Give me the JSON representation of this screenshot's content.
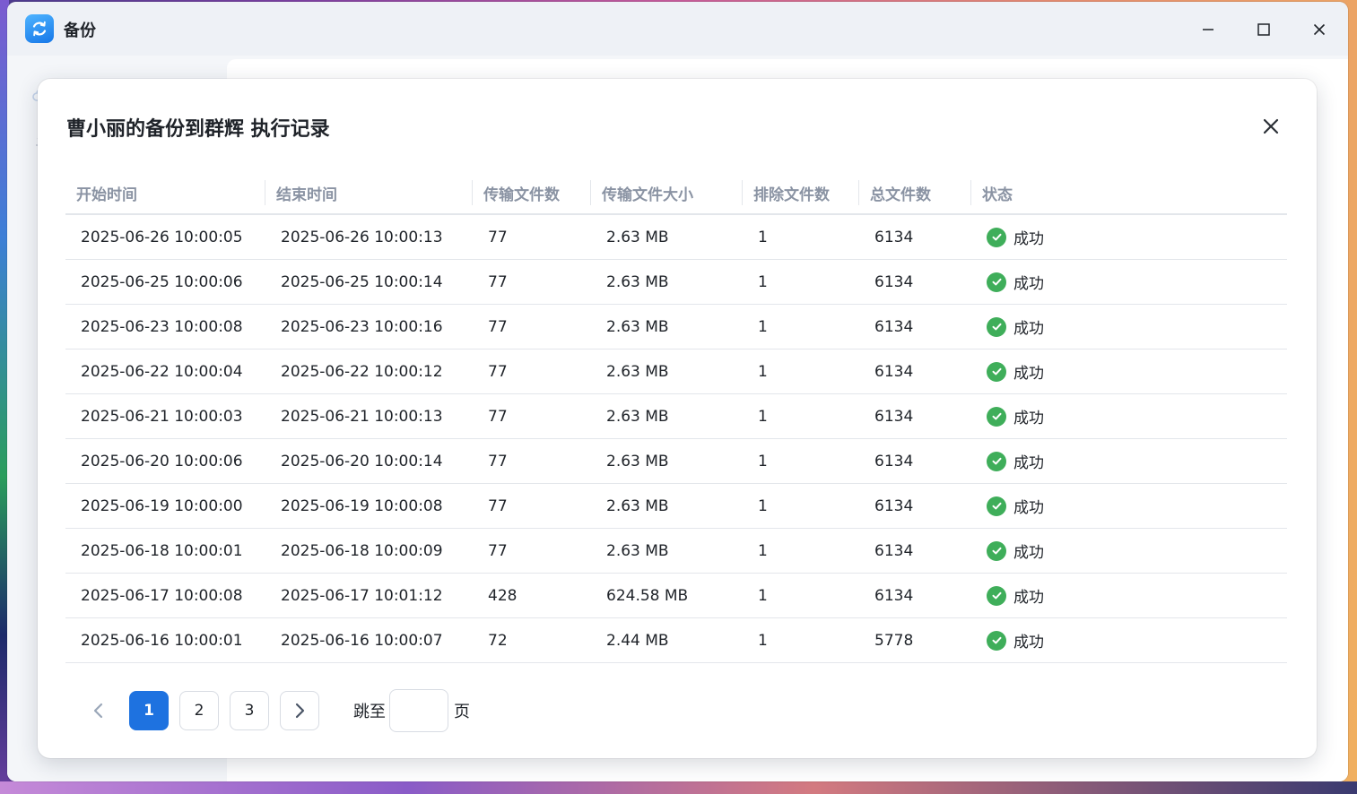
{
  "window": {
    "title": "备份",
    "controls": [
      "minimize-icon",
      "maximize-icon",
      "close-icon"
    ]
  },
  "dialog": {
    "title": "曹小丽的备份到群辉 执行记录",
    "columns": [
      "开始时间",
      "结束时间",
      "传输文件数",
      "传输文件大小",
      "排除文件数",
      "总文件数",
      "状态"
    ],
    "rows": [
      {
        "start": "2025-06-26 10:00:05",
        "end": "2025-06-26 10:00:13",
        "files": "77",
        "size": "2.63 MB",
        "excluded": "1",
        "total": "6134",
        "status": "成功"
      },
      {
        "start": "2025-06-25 10:00:06",
        "end": "2025-06-25 10:00:14",
        "files": "77",
        "size": "2.63 MB",
        "excluded": "1",
        "total": "6134",
        "status": "成功"
      },
      {
        "start": "2025-06-23 10:00:08",
        "end": "2025-06-23 10:00:16",
        "files": "77",
        "size": "2.63 MB",
        "excluded": "1",
        "total": "6134",
        "status": "成功"
      },
      {
        "start": "2025-06-22 10:00:04",
        "end": "2025-06-22 10:00:12",
        "files": "77",
        "size": "2.63 MB",
        "excluded": "1",
        "total": "6134",
        "status": "成功"
      },
      {
        "start": "2025-06-21 10:00:03",
        "end": "2025-06-21 10:00:13",
        "files": "77",
        "size": "2.63 MB",
        "excluded": "1",
        "total": "6134",
        "status": "成功"
      },
      {
        "start": "2025-06-20 10:00:06",
        "end": "2025-06-20 10:00:14",
        "files": "77",
        "size": "2.63 MB",
        "excluded": "1",
        "total": "6134",
        "status": "成功"
      },
      {
        "start": "2025-06-19 10:00:00",
        "end": "2025-06-19 10:00:08",
        "files": "77",
        "size": "2.63 MB",
        "excluded": "1",
        "total": "6134",
        "status": "成功"
      },
      {
        "start": "2025-06-18 10:00:01",
        "end": "2025-06-18 10:00:09",
        "files": "77",
        "size": "2.63 MB",
        "excluded": "1",
        "total": "6134",
        "status": "成功"
      },
      {
        "start": "2025-06-17 10:00:08",
        "end": "2025-06-17 10:01:12",
        "files": "428",
        "size": "624.58 MB",
        "excluded": "1",
        "total": "6134",
        "status": "成功"
      },
      {
        "start": "2025-06-16 10:00:01",
        "end": "2025-06-16 10:00:07",
        "files": "72",
        "size": "2.44 MB",
        "excluded": "1",
        "total": "5778",
        "status": "成功"
      }
    ],
    "pagination": {
      "pages": [
        "1",
        "2",
        "3"
      ],
      "current": "1",
      "jump_label": "跳至",
      "page_suffix": "页",
      "jump_value": ""
    }
  },
  "colors": {
    "accent": "#1e72e0",
    "success": "#3fae5a",
    "header_text": "#8a93a3"
  }
}
